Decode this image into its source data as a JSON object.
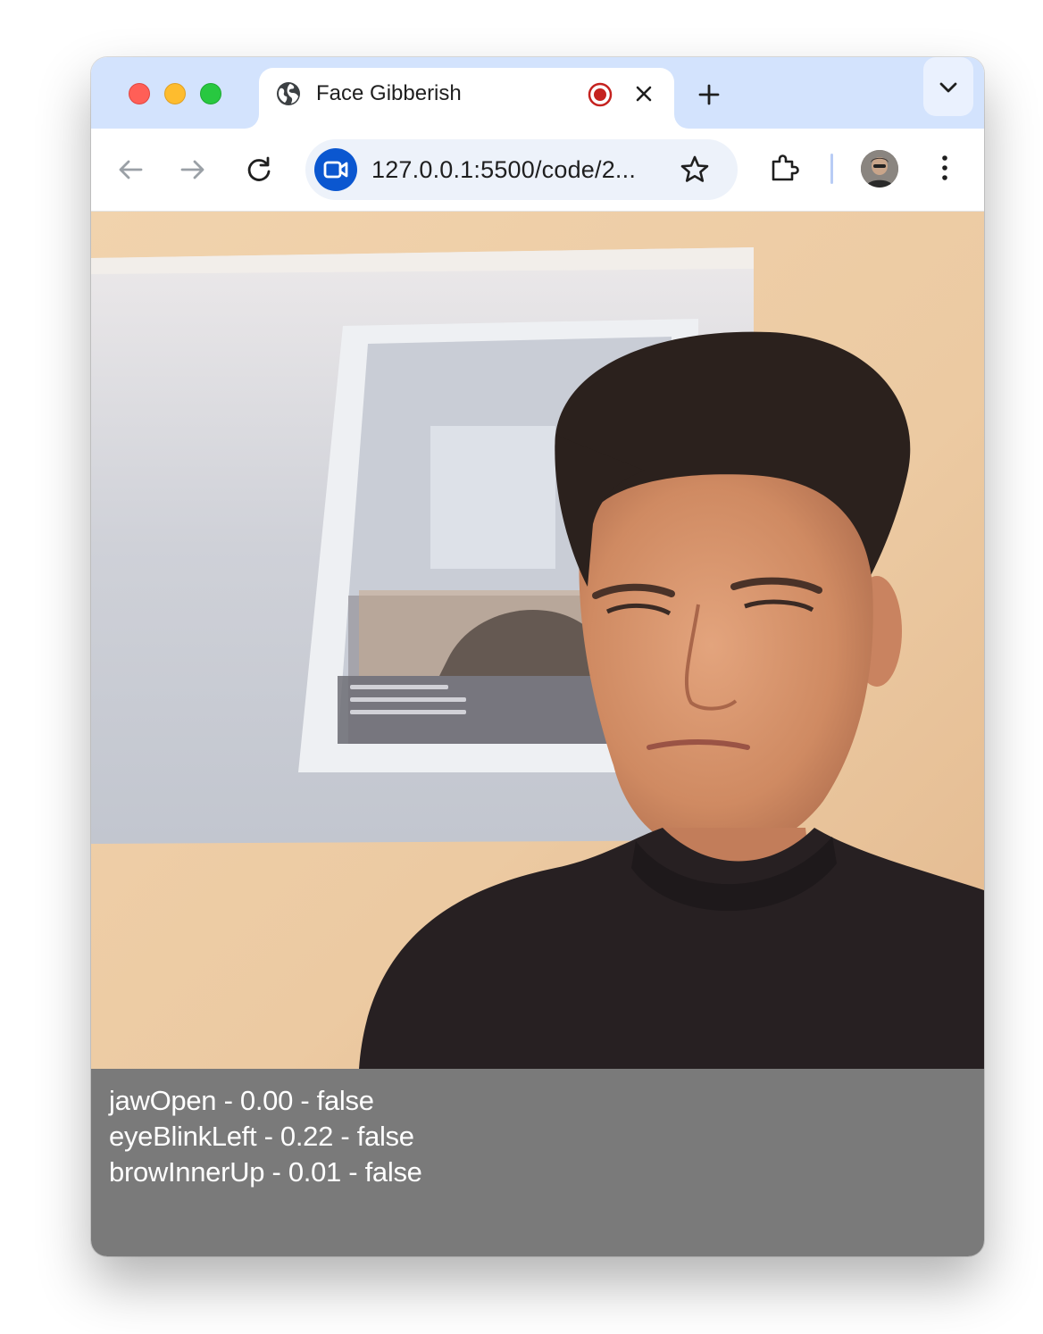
{
  "browser": {
    "tab": {
      "title": "Face Gibberish",
      "favicon": "globe-icon",
      "recording_indicator": "record-icon"
    },
    "address_bar": {
      "url": "127.0.0.1:5500/code/2...",
      "site_icon": "video-camera-icon"
    },
    "colors": {
      "tabstrip": "#d3e3fd",
      "omnibox": "#edf2fa",
      "site_chip": "#0b57d0",
      "record": "#c5221f"
    }
  },
  "overlay": {
    "background": "#7a7a7a",
    "lines": [
      "jawOpen - 0.00 - false",
      "eyeBlinkLeft - 0.22 - false",
      "browInnerUp - 0.01 - false"
    ]
  }
}
